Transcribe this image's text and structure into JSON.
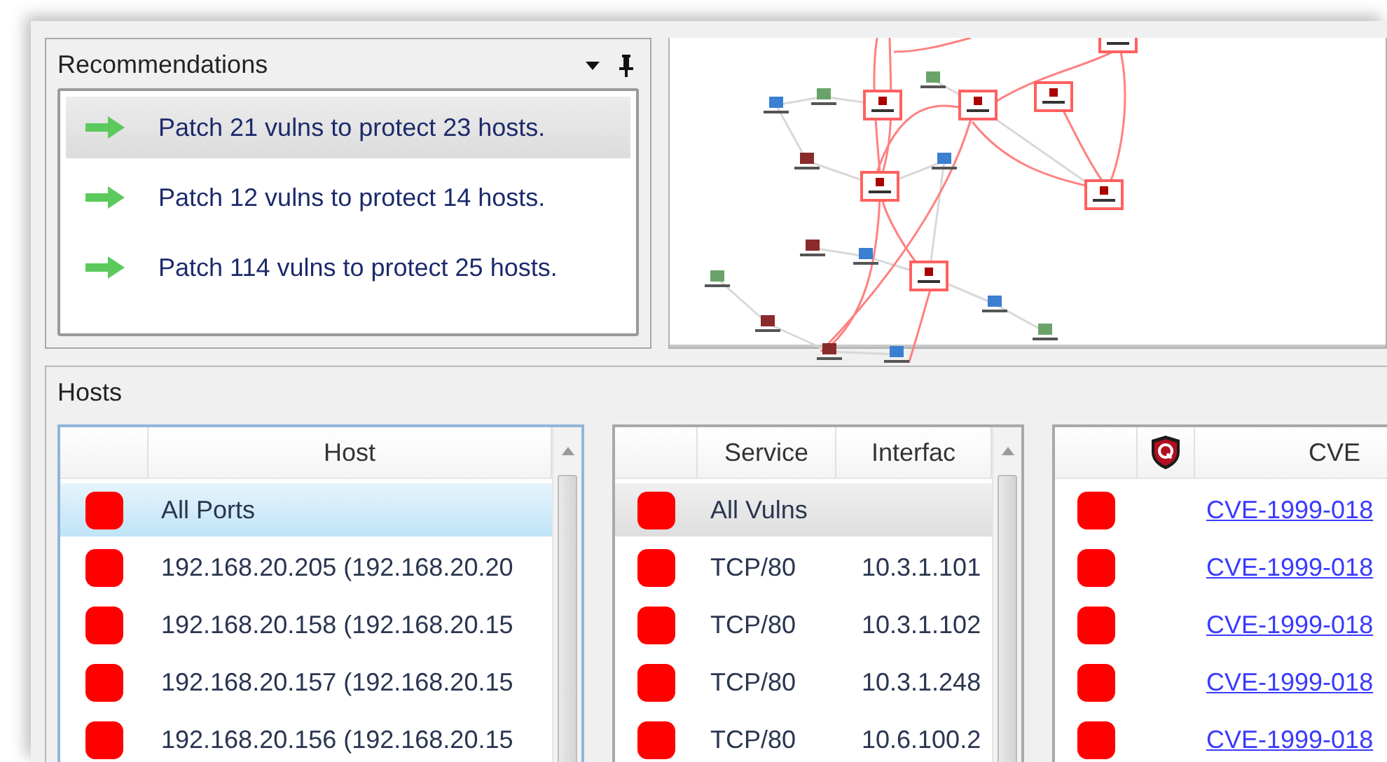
{
  "recommendations": {
    "title": "Recommendations",
    "items": [
      {
        "text": "Patch 21 vulns to protect 23 hosts.",
        "selected": true
      },
      {
        "text": "Patch 12 vulns to protect 14 hosts.",
        "selected": false
      },
      {
        "text": "Patch 114 vulns to protect 25 hosts.",
        "selected": false
      }
    ]
  },
  "hosts": {
    "title": "Hosts",
    "host_table": {
      "columns": [
        "Host"
      ],
      "rows": [
        {
          "host": "All Ports",
          "selected": true
        },
        {
          "host": "192.168.20.205 (192.168.20.20",
          "selected": false
        },
        {
          "host": "192.168.20.158 (192.168.20.15",
          "selected": false
        },
        {
          "host": "192.168.20.157 (192.168.20.15",
          "selected": false
        },
        {
          "host": "192.168.20.156 (192.168.20.15",
          "selected": false
        }
      ]
    },
    "service_table": {
      "columns": [
        "Service",
        "Interfac"
      ],
      "rows": [
        {
          "service": "All Vulns",
          "selected": true
        },
        {
          "service": "TCP/80",
          "interface": "10.3.1.101",
          "selected": false
        },
        {
          "service": "TCP/80",
          "interface": "10.3.1.102",
          "selected": false
        },
        {
          "service": "TCP/80",
          "interface": "10.3.1.248",
          "selected": false
        },
        {
          "service": "TCP/80",
          "interface": "10.6.100.2",
          "selected": false
        }
      ]
    },
    "cve_table": {
      "columns": [
        "CVE"
      ],
      "rows": [
        {
          "cve": "CVE-1999-018"
        },
        {
          "cve": "CVE-1999-018"
        },
        {
          "cve": "CVE-1999-018"
        },
        {
          "cve": "CVE-1999-018"
        },
        {
          "cve": "CVE-1999-018"
        }
      ]
    }
  }
}
